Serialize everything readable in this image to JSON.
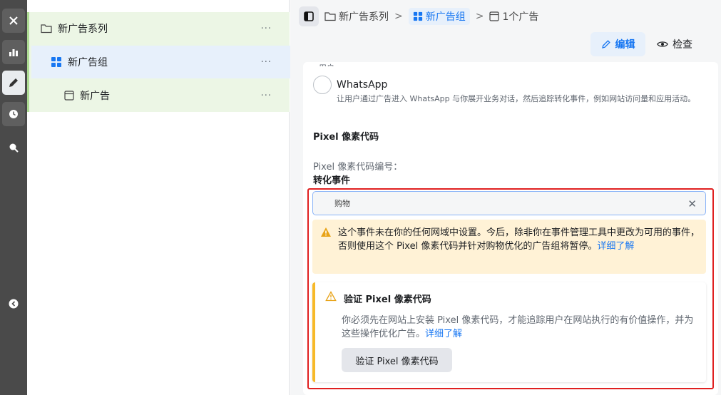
{
  "tree": {
    "campaign": "新广告系列",
    "adset": "新广告组",
    "ad": "新广告",
    "more": "···"
  },
  "breadcrumb": {
    "campaign": "新广告系列",
    "adset": "新广告组",
    "ad": "1个广告",
    "sep": ">"
  },
  "actions": {
    "edit": "编辑",
    "review": "检查"
  },
  "form": {
    "clipped_text": "用户。",
    "whatsapp_title": "WhatsApp",
    "whatsapp_desc": "让用户通过广告进入 WhatsApp 与你展开业务对话，然后追踪转化事件，例如网站访问量和应用活动。",
    "pixel_section": "Pixel 像素代码",
    "pixel_id_label": "Pixel 像素代码编号：",
    "conversion_label": "转化事件",
    "event_value": "购物",
    "clear": "✕",
    "warning_text": "这个事件未在你的任何网域中设置。今后，除非你在事件管理工具中更改为可用的事件，否则使用这个 Pixel 像素代码并针对购物优化的广告组将暂停。",
    "warning_link": "详细了解",
    "verify_title": "验证 Pixel 像素代码",
    "verify_desc": "你必须先在网站上安装 Pixel 像素代码，才能追踪用户在网站执行的有价值操作，并为这些操作优化广告。",
    "verify_link": "详细了解",
    "verify_button": "验证 Pixel 像素代码"
  },
  "colors": {
    "accent": "#1877f2",
    "warning": "#f7b928",
    "highlight_border": "#e02020"
  }
}
